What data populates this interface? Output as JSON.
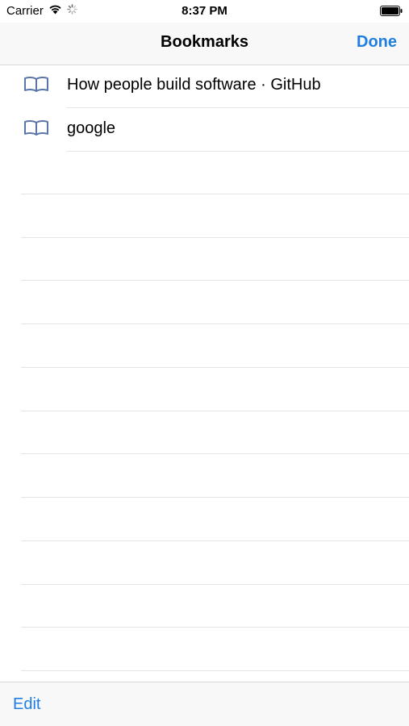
{
  "status_bar": {
    "carrier": "Carrier",
    "time": "8:37 PM",
    "wifi_icon": "wifi-icon",
    "activity_icon": "activity-spinner-icon",
    "battery_icon": "battery-icon"
  },
  "nav": {
    "title": "Bookmarks",
    "done_label": "Done"
  },
  "bookmarks": [
    {
      "title": "How people build software · GitHub",
      "icon": "book-icon"
    },
    {
      "title": "google",
      "icon": "book-icon"
    }
  ],
  "toolbar": {
    "edit_label": "Edit"
  },
  "colors": {
    "accent": "#1f7ee0",
    "icon": "#5a76a8",
    "separator": "#e4e4e6",
    "bar_background": "#f8f8f8"
  }
}
